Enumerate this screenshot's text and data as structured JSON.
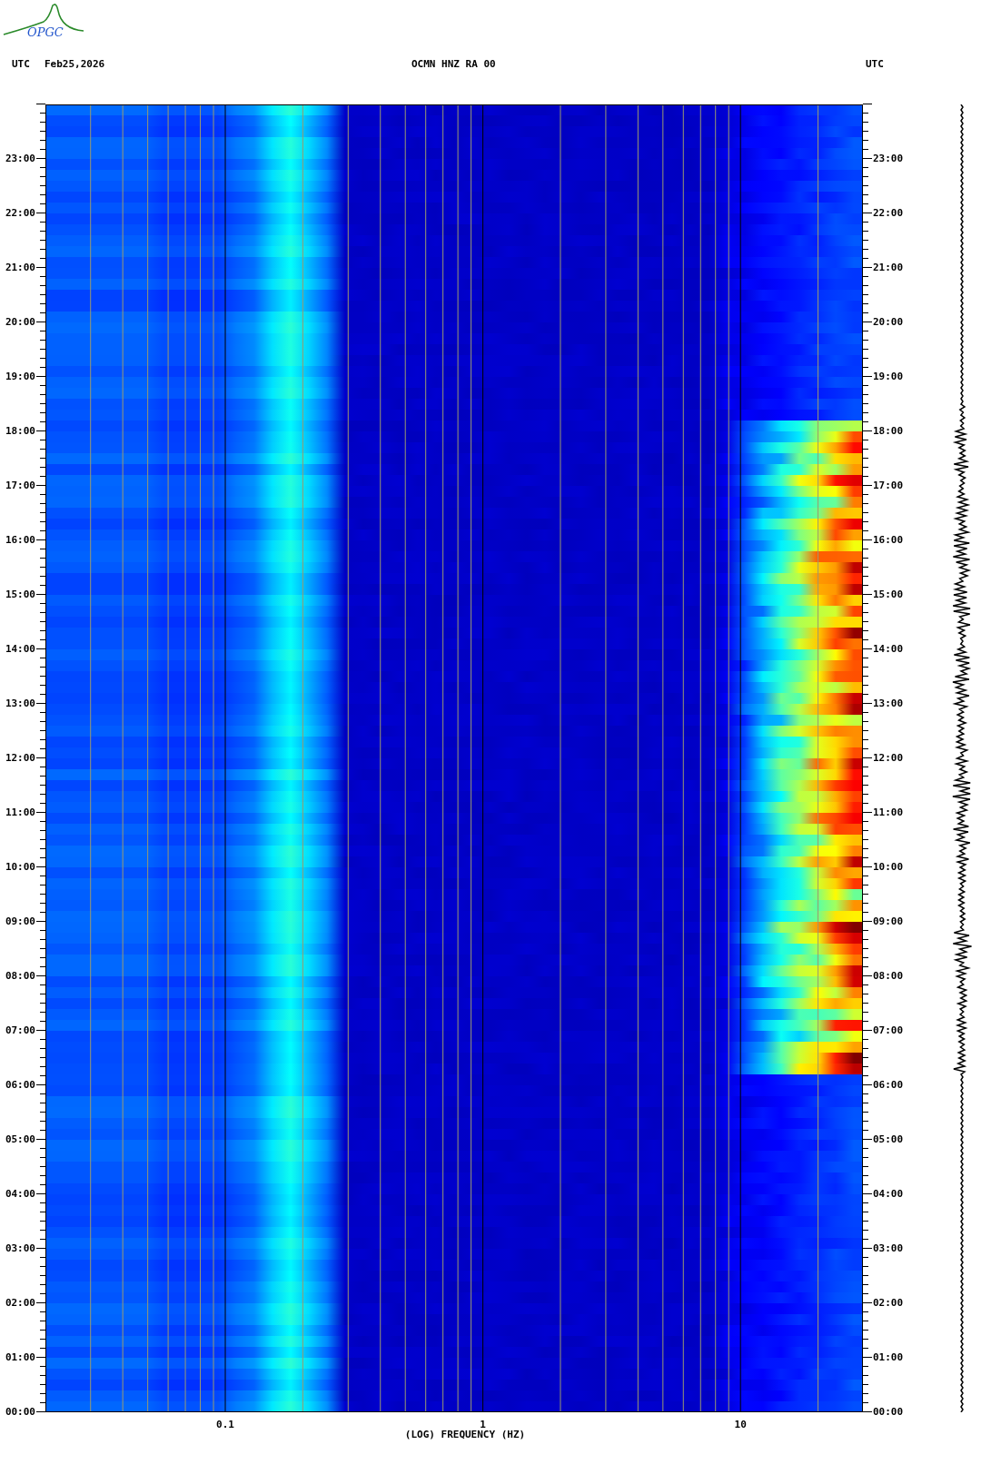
{
  "header": {
    "logo_text": "OPGC",
    "left_zone": "UTC",
    "date": "Feb25,2026",
    "station": "OCMN HNZ RA 00",
    "right_zone": "UTC"
  },
  "chart": {
    "left_time_labels": [
      "23:00",
      "22:00",
      "21:00",
      "20:00",
      "19:00",
      "18:00",
      "17:00",
      "16:00",
      "15:00",
      "14:00",
      "13:00",
      "12:00",
      "11:00",
      "10:00",
      "09:00",
      "08:00",
      "07:00",
      "06:00",
      "05:00",
      "04:00",
      "03:00",
      "02:00",
      "01:00",
      "00:00"
    ],
    "right_time_labels": [
      "23:00",
      "22:00",
      "21:00",
      "20:00",
      "19:00",
      "18:00",
      "17:00",
      "16:00",
      "15:00",
      "14:00",
      "13:00",
      "12:00",
      "11:00",
      "10:00",
      "09:00",
      "08:00",
      "07:00",
      "06:00",
      "05:00",
      "04:00",
      "03:00",
      "02:00",
      "01:00",
      "00:00"
    ],
    "frequency_ticks": [
      "0.1",
      "1",
      "10"
    ],
    "xlabel": "(LOG) FREQUENCY (HZ)"
  }
}
